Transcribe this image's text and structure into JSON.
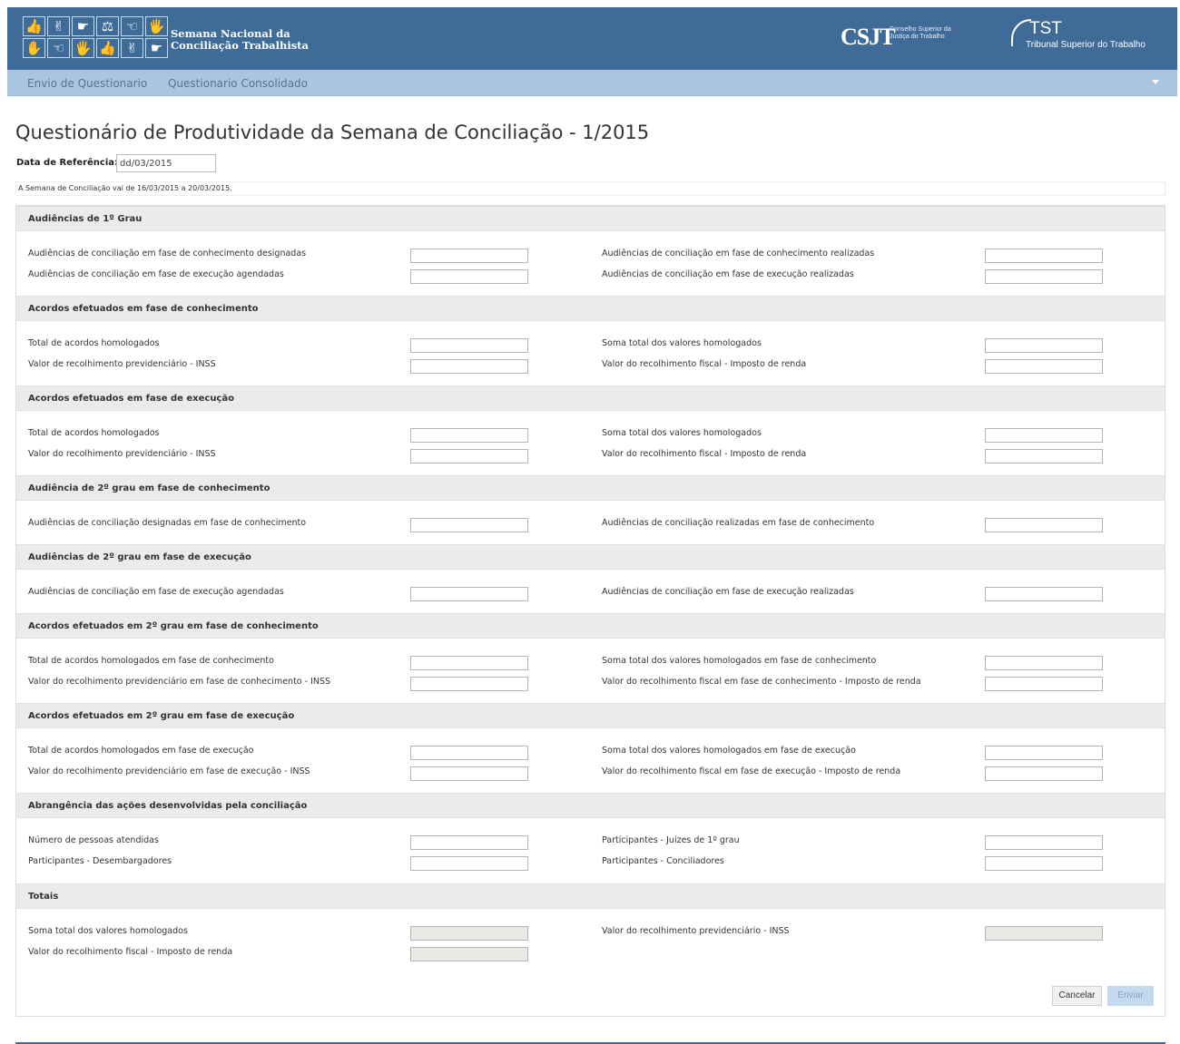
{
  "header": {
    "brand_line1": "Semana Nacional da",
    "brand_line2": "Conciliação Trabalhista",
    "csjt_mark": "CSJT",
    "csjt_sub1": "Conselho Superior da",
    "csjt_sub2": "Justiça do Trabalho",
    "tst_mark": "TST",
    "tst_sub": "Tribunal Superior do Trabalho",
    "logo_tiles": [
      "👍",
      "✌",
      "☛",
      "⚖",
      "☜",
      "🖐",
      "✋",
      "☜",
      "🖐",
      "👍",
      "✌",
      "☛"
    ],
    "brand_color": "#3f6b98"
  },
  "nav": {
    "items": [
      "Envio de Questionario",
      "Questionario Consolidado"
    ],
    "accent": "#aac5e2"
  },
  "page": {
    "title": "Questionário de Produtividade da Semana de Conciliação - 1/2015",
    "ref_label": "Data de Referência:",
    "ref_value": "dd/03/2015",
    "info": "A Semana de Conciliação vai de 16/03/2015 a 20/03/2015."
  },
  "sections": [
    {
      "title": "Audiências de 1º Grau",
      "fields": [
        "Audiências de conciliação em fase de conhecimento designadas",
        "Audiências de conciliação em fase de conhecimento realizadas",
        "Audiências de conciliação em fase de execução agendadas",
        "Audiências de conciliação em fase de execução realizadas"
      ]
    },
    {
      "title": "Acordos efetuados em fase de conhecimento",
      "fields": [
        "Total de acordos homologados",
        "Soma total dos valores homologados",
        "Valor de recolhimento previdenciário - INSS",
        "Valor do recolhimento fiscal - Imposto de renda"
      ]
    },
    {
      "title": "Acordos efetuados em fase de execução",
      "fields": [
        "Total de acordos homologados",
        "Soma total dos valores homologados",
        "Valor do recolhimento previdenciário - INSS",
        "Valor do recolhimento fiscal - Imposto de renda"
      ]
    },
    {
      "title": "Audiência de 2º grau em fase de conhecimento",
      "fields": [
        "Audiências de conciliação designadas em fase de conhecimento",
        "Audiências de conciliação realizadas em fase de conhecimento"
      ]
    },
    {
      "title": "Audiências de 2º grau em fase de execução",
      "fields": [
        "Audiências de conciliação em fase de execução agendadas",
        "Audiências de conciliação em fase de execução realizadas"
      ]
    },
    {
      "title": "Acordos efetuados em 2º grau em fase de conhecimento",
      "fields": [
        "Total de acordos homologados em fase de conhecimento",
        "Soma total dos valores homologados em fase de conhecimento",
        "Valor do recolhimento previdenciário em fase de conhecimento - INSS",
        "Valor do recolhimento fiscal em fase de conhecimento - Imposto de renda"
      ]
    },
    {
      "title": "Acordos efetuados em 2º grau em fase de execução",
      "fields": [
        "Total de acordos homologados em fase de execução",
        "Soma total dos valores homologados em fase de execução",
        "Valor do recolhimento previdenciário em fase de execução - INSS",
        "Valor do recolhimento fiscal em fase de execução - Imposto de renda"
      ]
    },
    {
      "title": "Abrangência das ações desenvolvidas pela conciliação",
      "fields": [
        "Número de pessoas atendidas",
        "Participantes - Juizes de 1º grau",
        "Participantes - Desembargadores",
        "Participantes - Conciliadores"
      ]
    },
    {
      "title": "Totais",
      "readonly": true,
      "fields": [
        "Soma total dos valores homologados",
        "Valor do recolhimento previdenciário - INSS",
        "Valor do recolhimento fiscal - Imposto de renda"
      ]
    }
  ],
  "buttons": {
    "cancel": "Cancelar",
    "send": "Enviar"
  }
}
